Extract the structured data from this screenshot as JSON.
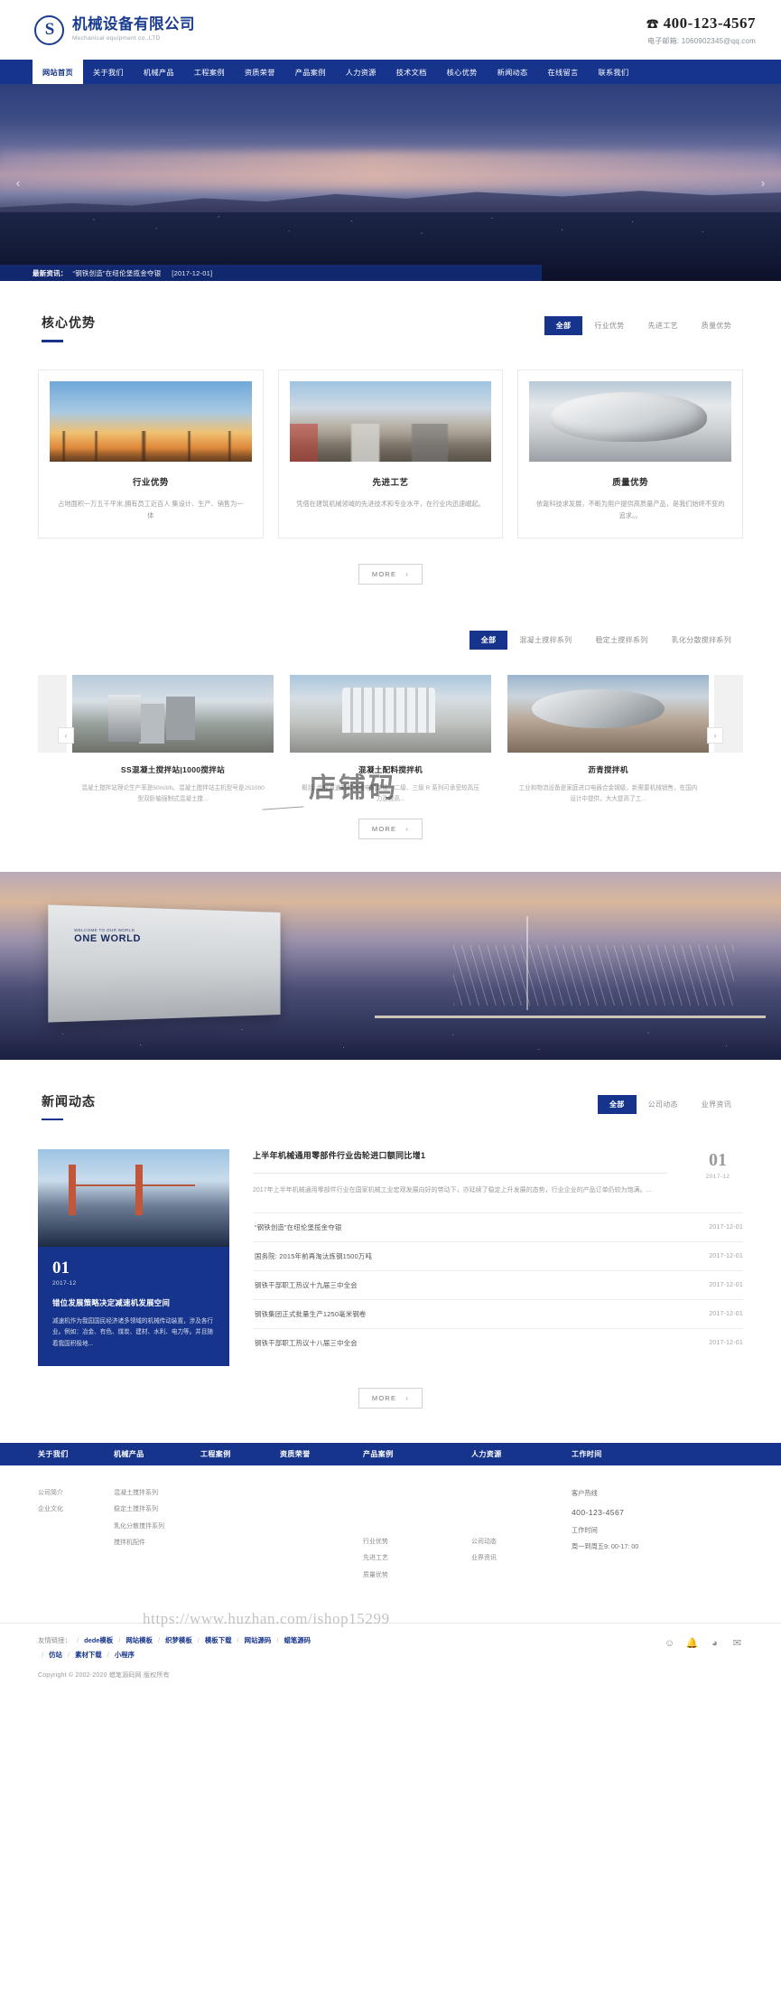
{
  "header": {
    "logo_glyph": "S",
    "company_cn": "机械设备有限公司",
    "company_en": "Mechanical equipment co.,LTD",
    "phone": "400-123-4567",
    "email_label": "电子邮箱:",
    "email": "1060902345@qq.com",
    "accent_color": "#16348c"
  },
  "nav": {
    "items": [
      {
        "label": "网站首页",
        "active": true
      },
      {
        "label": "关于我们",
        "active": false
      },
      {
        "label": "机械产品",
        "active": false
      },
      {
        "label": "工程案例",
        "active": false
      },
      {
        "label": "资质荣誉",
        "active": false
      },
      {
        "label": "产品案例",
        "active": false
      },
      {
        "label": "人力资源",
        "active": false
      },
      {
        "label": "技术文档",
        "active": false
      },
      {
        "label": "核心优势",
        "active": false
      },
      {
        "label": "新闻动态",
        "active": false
      },
      {
        "label": "在线留言",
        "active": false
      },
      {
        "label": "联系我们",
        "active": false
      }
    ]
  },
  "banner": {
    "prev_arrow": "‹",
    "next_arrow": "›",
    "ticker_label": "最新资讯：",
    "ticker_text": "“钢铁创造”在纽伦堡揽金夺银",
    "ticker_date": "[2017-12-01]"
  },
  "advantages": {
    "title": "核心优势",
    "tabs": [
      {
        "label": "全部",
        "active": true
      },
      {
        "label": "行业优势",
        "active": false
      },
      {
        "label": "先进工艺",
        "active": false
      },
      {
        "label": "质量优势",
        "active": false
      }
    ],
    "cards": [
      {
        "title": "行业优势",
        "desc": "占地面积一万五千平米,拥有员工近百人 集设计、生产、销售为一体"
      },
      {
        "title": "先进工艺",
        "desc": "凭借在建筑机械领域的先进技术和专业水平，在行业内迅速崛起。"
      },
      {
        "title": "质量优势",
        "desc": "依靠科技求发展，不断为用户提供高质量产品，是我们始终不变的追求。。"
      }
    ],
    "more_label": "MORE",
    "more_chev": "›"
  },
  "products": {
    "tabs": [
      {
        "label": "全部",
        "active": true
      },
      {
        "label": "混凝土搅拌系列",
        "active": false
      },
      {
        "label": "稳定土搅拌系列",
        "active": false
      },
      {
        "label": "乳化分散搅拌系列",
        "active": false
      }
    ],
    "prev_arrow": "‹",
    "next_arrow": "›",
    "items": [
      {
        "title": "SS混凝土搅拌站|1000搅拌站",
        "desc": "混凝土搅拌站理论生产率是50m3/h。混凝土搅拌站主机型号是JS1000型双卧轴强制式混凝土搅..."
      },
      {
        "title": "混凝土配料搅拌机",
        "desc": "概括: 齿轮减速机和减速电机单级、二级、三级 R 系列可承受较高压力及较高..."
      },
      {
        "title": "沥青搅拌机",
        "desc": "工业和物流设备是家庭进口电器合金钢级，新需要机械销售，在国内设计中提供，大大提高了工..."
      }
    ],
    "watermark": "店铺码",
    "more_label": "MORE",
    "more_chev": "›"
  },
  "band": {
    "warehouse_small": "WELCOME TO OUR WORLD",
    "warehouse_big": "ONE WORLD"
  },
  "news": {
    "title": "新闻动态",
    "tabs": [
      {
        "label": "全部",
        "active": true
      },
      {
        "label": "公司动态",
        "active": false
      },
      {
        "label": "业界资讯",
        "active": false
      }
    ],
    "feature": {
      "day": "01",
      "ym": "2017-12",
      "title": "错位发展策略决定减速机发展空间",
      "desc": "减速机作为我国国民经济诸多领域的机械传动装置，涉及各行业。例如：冶金、有色、煤炭、建材、水利、电力等。并且随着我国积极地..."
    },
    "top": {
      "title": "上半年机械通用零部件行业齿轮进口额同比增1",
      "desc": "2017年上半年机械通用零部件行业在国家机械工业宏观发展向好的带动下，亦延续了稳定上升发展的态势，行业企业的产品订单仍较为饱满。...",
      "day": "01",
      "ym": "2017-12"
    },
    "items": [
      {
        "title": "“钢铁创造”在纽伦堡揽金夺银",
        "date": "2017-12-01"
      },
      {
        "title": "国务院: 2015年前再淘汰炼钢1500万吨",
        "date": "2017-12-01"
      },
      {
        "title": "钢铁干部职工热议十九届三中全会",
        "date": "2017-12-01"
      },
      {
        "title": "钢铁集团正式批量生产1250毫米钢卷",
        "date": "2017-12-01"
      },
      {
        "title": "钢铁干部职工热议十八届三中全会",
        "date": "2017-12-01"
      }
    ],
    "more_label": "MORE",
    "more_chev": "›"
  },
  "footer": {
    "nav": [
      "关于我们",
      "机械产品",
      "工程案例",
      "资质荣誉",
      "产品案例",
      "人力资源",
      "工作时间"
    ],
    "col_about": [
      "公司简介",
      "企业文化"
    ],
    "col_products": [
      "混凝土搅拌系列",
      "稳定土搅拌系列",
      "乳化分散搅拌系列",
      "搅拌机配件"
    ],
    "col_advantages": [
      "行业优势",
      "先进工艺",
      "质量优势"
    ],
    "col_news": [
      "公司动态",
      "业界资讯"
    ],
    "hotline_label": "客户热线",
    "hotline": "400-123-4567",
    "worktime_label": "工作时间",
    "worktime": "周一到周五9: 00-17: 00",
    "watermark_url": "https://www.huzhan.com/ishop15299",
    "friend_label": "友情链接：",
    "friend_links": [
      "dede模板",
      "网站模板",
      "织梦模板",
      "模板下载",
      "网站源码",
      "蜡笔源码",
      "仿站",
      "素材下载",
      "小程序"
    ],
    "social_icons": [
      "wechat-icon",
      "bell-icon",
      "weibo-icon",
      "mail-icon"
    ],
    "copyright": "Copyright © 2002-2020 蜡笔源码网 版权所有"
  }
}
